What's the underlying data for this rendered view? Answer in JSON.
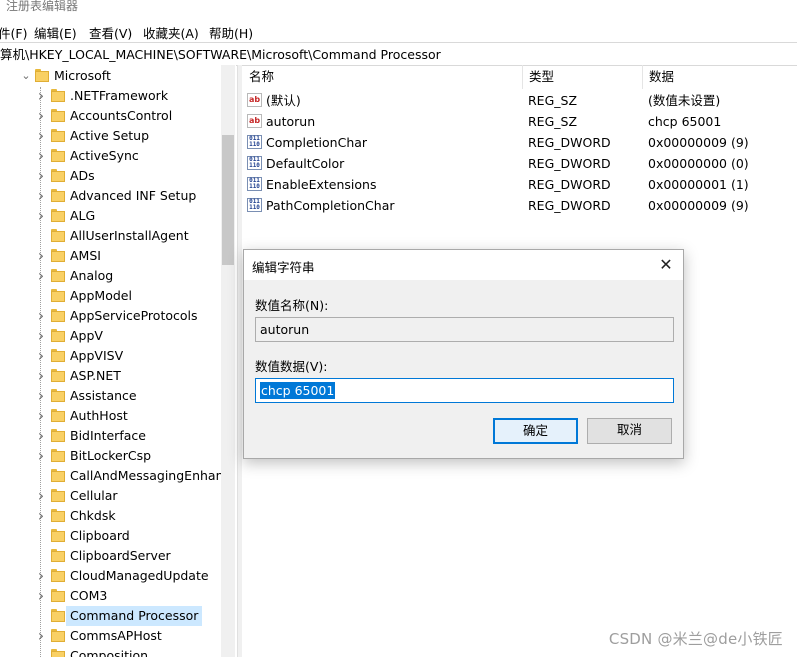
{
  "window": {
    "title": "注册表编辑器"
  },
  "menu": [
    "件(F)",
    "编辑(E)",
    "查看(V)",
    "收藏夹(A)",
    "帮助(H)"
  ],
  "address": "算机\\HKEY_LOCAL_MACHINE\\SOFTWARE\\Microsoft\\Command Processor",
  "tree": {
    "parent": "Microsoft",
    "items": [
      {
        "label": ".NETFramework",
        "expandable": true
      },
      {
        "label": "AccountsControl",
        "expandable": true
      },
      {
        "label": "Active Setup",
        "expandable": true
      },
      {
        "label": "ActiveSync",
        "expandable": true
      },
      {
        "label": "ADs",
        "expandable": true
      },
      {
        "label": "Advanced INF Setup",
        "expandable": true
      },
      {
        "label": "ALG",
        "expandable": true
      },
      {
        "label": "AllUserInstallAgent",
        "expandable": false
      },
      {
        "label": "AMSI",
        "expandable": true
      },
      {
        "label": "Analog",
        "expandable": true
      },
      {
        "label": "AppModel",
        "expandable": false
      },
      {
        "label": "AppServiceProtocols",
        "expandable": true
      },
      {
        "label": "AppV",
        "expandable": true
      },
      {
        "label": "AppVISV",
        "expandable": true
      },
      {
        "label": "ASP.NET",
        "expandable": true
      },
      {
        "label": "Assistance",
        "expandable": true
      },
      {
        "label": "AuthHost",
        "expandable": true
      },
      {
        "label": "BidInterface",
        "expandable": true
      },
      {
        "label": "BitLockerCsp",
        "expandable": true
      },
      {
        "label": "CallAndMessagingEnhanc",
        "expandable": false
      },
      {
        "label": "Cellular",
        "expandable": true
      },
      {
        "label": "Chkdsk",
        "expandable": true
      },
      {
        "label": "Clipboard",
        "expandable": false
      },
      {
        "label": "ClipboardServer",
        "expandable": false
      },
      {
        "label": "CloudManagedUpdate",
        "expandable": true
      },
      {
        "label": "COM3",
        "expandable": true
      },
      {
        "label": "Command Processor",
        "expandable": false,
        "selected": true
      },
      {
        "label": "CommsAPHost",
        "expandable": true
      },
      {
        "label": "Composition",
        "expandable": false
      }
    ]
  },
  "list": {
    "columns": [
      "名称",
      "类型",
      "数据"
    ],
    "rows": [
      {
        "name": "(默认)",
        "type": "REG_SZ",
        "data": "(数值未设置)",
        "icon": "string-value-icon"
      },
      {
        "name": "autorun",
        "type": "REG_SZ",
        "data": "chcp 65001",
        "icon": "string-value-icon"
      },
      {
        "name": "CompletionChar",
        "type": "REG_DWORD",
        "data": "0x00000009 (9)",
        "icon": "dword-value-icon"
      },
      {
        "name": "DefaultColor",
        "type": "REG_DWORD",
        "data": "0x00000000 (0)",
        "icon": "dword-value-icon"
      },
      {
        "name": "EnableExtensions",
        "type": "REG_DWORD",
        "data": "0x00000001 (1)",
        "icon": "dword-value-icon"
      },
      {
        "name": "PathCompletionChar",
        "type": "REG_DWORD",
        "data": "0x00000009 (9)",
        "icon": "dword-value-icon"
      }
    ]
  },
  "dialog": {
    "title": "编辑字符串",
    "name_label": "数值名称(N):",
    "name_value": "autorun",
    "data_label": "数值数据(V):",
    "data_value": "chcp 65001",
    "ok_label": "确定",
    "cancel_label": "取消"
  },
  "watermark": "CSDN @米兰@de小铁匠",
  "colors": {
    "selection": "#0078d7",
    "folder": "#f9d064",
    "tree_selected": "#cce8ff"
  }
}
